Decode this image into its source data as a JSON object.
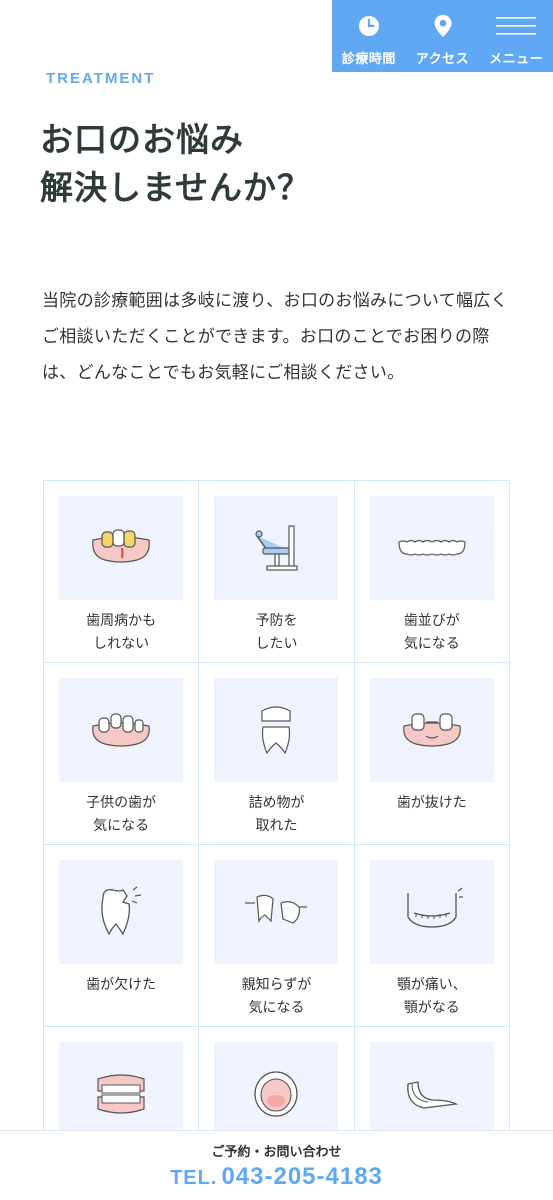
{
  "nav": {
    "hours_label": "診療時間",
    "access_label": "アクセス",
    "menu_label": "メニュー"
  },
  "header": {
    "eyebrow": "TREATMENT",
    "title_line1": "お口のお悩み",
    "title_line2": "解決しませんか？"
  },
  "lead": "当院の診療範囲は多岐に渡り、お口のお悩みについて幅広くご相談いただくことができます。お口のことでお困りの際は、どんなことでもお気軽にご相談ください。",
  "items": [
    {
      "label": "歯周病かも\nしれない",
      "icon": "gum-disease-icon"
    },
    {
      "label": "予防を\nしたい",
      "icon": "dental-chair-icon"
    },
    {
      "label": "歯並びが\n気になる",
      "icon": "aligned-teeth-icon"
    },
    {
      "label": "子供の歯が\n気になる",
      "icon": "child-teeth-icon"
    },
    {
      "label": "詰め物が\n取れた",
      "icon": "crown-tooth-icon"
    },
    {
      "label": "歯が抜けた",
      "icon": "missing-tooth-icon"
    },
    {
      "label": "歯が欠けた",
      "icon": "chipped-tooth-icon"
    },
    {
      "label": "親知らずが\n気になる",
      "icon": "wisdom-tooth-icon"
    },
    {
      "label": "顎が痛い、\n顎がなる",
      "icon": "jaw-icon"
    },
    {
      "label": "",
      "icon": "dentures-icon"
    },
    {
      "label": "",
      "icon": "open-mouth-icon"
    },
    {
      "label": "",
      "icon": "mouthpiece-icon"
    }
  ],
  "contact": {
    "label": "ご予約・お問い合わせ",
    "tel_prefix": "TEL.",
    "tel": "043-205-4183"
  },
  "colors": {
    "accent": "#60a8f4",
    "panel": "#eef3fd",
    "border": "#d3e5f8",
    "gum": "#f6c9c6",
    "gold": "#f3d56a"
  }
}
